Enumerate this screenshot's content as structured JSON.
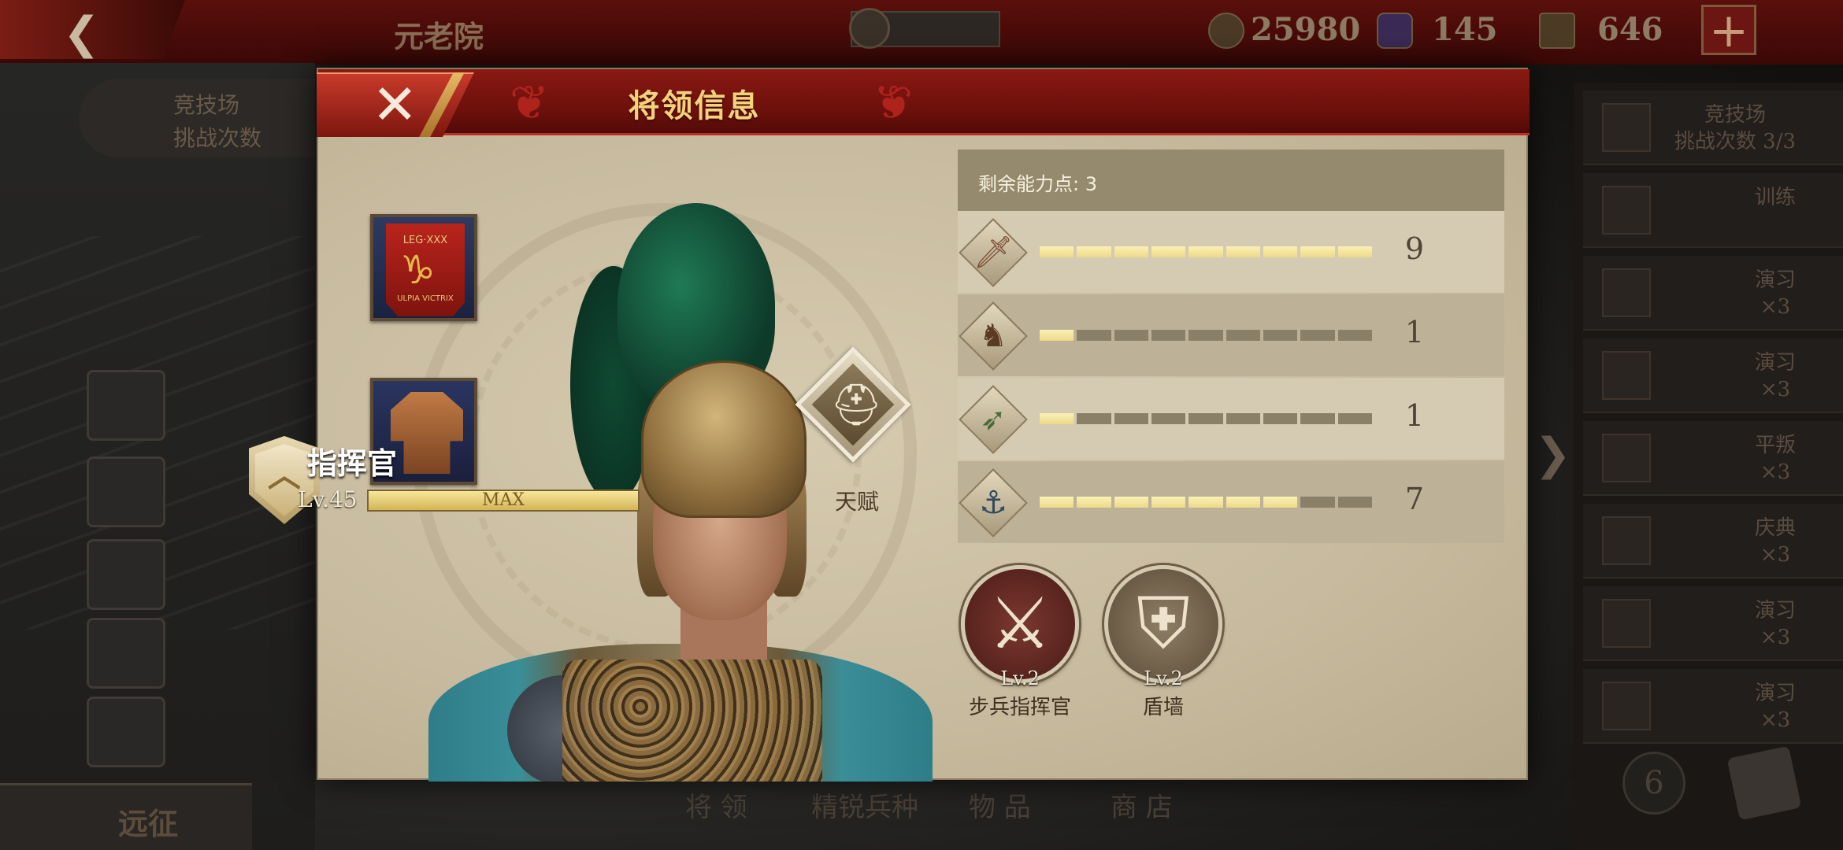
{
  "background": {
    "screen_title": "元老院",
    "resources": {
      "coins": "25980",
      "gems": "145",
      "helmets": "646"
    },
    "plus_label": "+",
    "left_panel": {
      "arena": "竞技场",
      "challenges": "挑战次数"
    },
    "expedition": "远征",
    "bottom_tabs": [
      "将 领",
      "精锐兵种",
      "物 品",
      "商 店"
    ],
    "right_sidebar": [
      {
        "label": "竞技场\n挑战次数 3/3"
      },
      {
        "label": "训练"
      },
      {
        "label": "演习\n×3"
      },
      {
        "label": "演习\n×3"
      },
      {
        "label": "平叛\n×3"
      },
      {
        "label": "庆典\n×3"
      },
      {
        "label": "演习\n×3"
      },
      {
        "label": "演习\n×3"
      }
    ],
    "round_button": "6"
  },
  "dialog": {
    "title": "将领信息",
    "close_label": "✕"
  },
  "equipment": {
    "banner_top": "LEG·XXX",
    "banner_bottom": "ULPIA VICTRIX"
  },
  "general": {
    "rank_name": "指挥官",
    "level_label": "Lv.45",
    "xp_label": "MAX"
  },
  "talent": {
    "label": "天赋"
  },
  "stats": {
    "remaining_points": "剩余能力点: 3",
    "max_points": 9,
    "rows": [
      {
        "icon": "sword-icon",
        "value": 9
      },
      {
        "icon": "horse-icon",
        "value": 1
      },
      {
        "icon": "bow-icon",
        "value": 1
      },
      {
        "icon": "anchor-icon",
        "value": 7
      }
    ]
  },
  "skills": [
    {
      "level": "Lv.2",
      "name": "步兵指挥官",
      "icon": "crossed-swords-icon"
    },
    {
      "level": "Lv.2",
      "name": "盾墙",
      "icon": "shield-wall-icon"
    }
  ],
  "colors": {
    "header_red": "#7a140e",
    "title_gold": "#f3d27a",
    "bar_on": "#f4e59e",
    "bar_off": "#8a8068",
    "panel": "#c7ba9e"
  }
}
